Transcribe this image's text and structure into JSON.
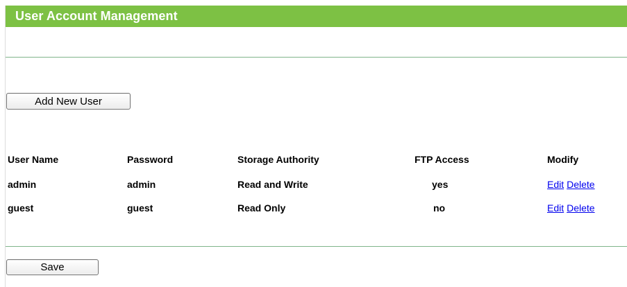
{
  "title": "User Account Management",
  "buttons": {
    "add_new_user": "Add New User",
    "save": "Save"
  },
  "table": {
    "headers": {
      "user_name": "User Name",
      "password": "Password",
      "storage_authority": "Storage Authority",
      "ftp_access": "FTP Access",
      "modify": "Modify"
    },
    "rows": [
      {
        "user_name": "admin",
        "password": "admin",
        "storage_authority": "Read and Write",
        "ftp_access": "yes",
        "edit": "Edit",
        "delete": "Delete"
      },
      {
        "user_name": "guest",
        "password": "guest",
        "storage_authority": "Read Only",
        "ftp_access": "no",
        "edit": "Edit",
        "delete": "Delete"
      }
    ]
  },
  "colors": {
    "title_bar": "#7dc144",
    "divider": "#7fb48a",
    "link": "#0000ee"
  }
}
